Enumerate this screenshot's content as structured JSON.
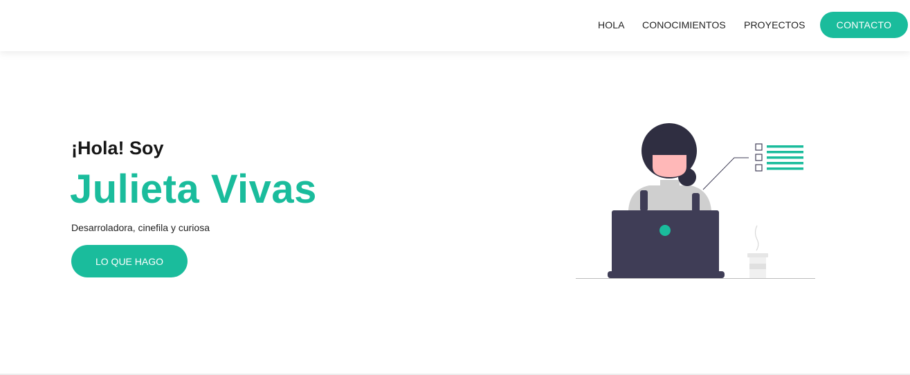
{
  "colors": {
    "accent": "#1abc9c",
    "accent_dark": "#16b39b",
    "dark": "#3f3d56",
    "hair": "#2f2e41",
    "skin": "#ffb8b8",
    "shirt": "#cfcfcf"
  },
  "nav": {
    "items": [
      {
        "label": "HOLA"
      },
      {
        "label": "CONOCIMIENTOS"
      },
      {
        "label": "PROYECTOS"
      }
    ],
    "contact_label": "CONTACTO"
  },
  "hero": {
    "greeting": "¡Hola! Soy",
    "name": "Julieta Vivas",
    "tagline": "Desarroladora, cinefila y curiosa",
    "cta_label": "LO QUE HAGO"
  },
  "illustration": {
    "icon": "woman-at-laptop-illustration"
  }
}
